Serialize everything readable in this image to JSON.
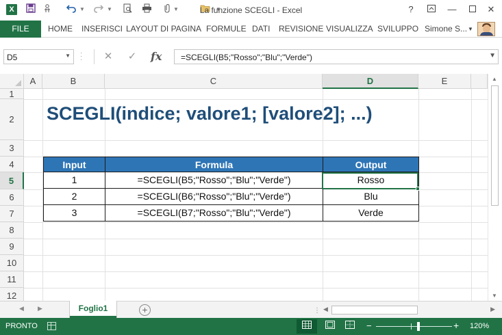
{
  "window": {
    "title": "La funzione SCEGLI - Excel",
    "app_icon": "X",
    "help": "?"
  },
  "quick_access": {
    "save_icon": "save-icon",
    "undo_icon": "undo-icon",
    "redo_icon": "redo-icon"
  },
  "ribbon": {
    "file": "FILE",
    "tabs": [
      "HOME",
      "INSERISCI",
      "LAYOUT DI PAGINA",
      "FORMULE",
      "DATI",
      "REVISIONE",
      "VISUALIZZA",
      "SVILUPPO"
    ],
    "user": "Simone S..."
  },
  "formula_bar": {
    "name_box": "D5",
    "fx": "fx",
    "formula": "=SCEGLI(B5;\"Rosso\";\"Blu\";\"Verde\")"
  },
  "grid": {
    "columns": [
      "A",
      "B",
      "C",
      "D",
      "E"
    ],
    "selected_column": "D",
    "rows": [
      "1",
      "2",
      "3",
      "4",
      "5",
      "6",
      "7",
      "8",
      "9",
      "10",
      "11",
      "12"
    ],
    "selected_row": "5"
  },
  "sheet": {
    "heading": "SCEGLI(indice; valore1; [valore2]; ...)",
    "table": {
      "headers": [
        "Input",
        "Formula",
        "Output"
      ],
      "rows": [
        [
          "1",
          "=SCEGLI(B5;\"Rosso\";\"Blu\";\"Verde\")",
          "Rosso"
        ],
        [
          "2",
          "=SCEGLI(B6;\"Rosso\";\"Blu\";\"Verde\")",
          "Blu"
        ],
        [
          "3",
          "=SCEGLI(B7;\"Rosso\";\"Blu\";\"Verde\")",
          "Verde"
        ]
      ]
    }
  },
  "sheet_tabs": {
    "active": "Foglio1",
    "add": "+"
  },
  "status": {
    "text": "PRONTO",
    "zoom": "120%"
  },
  "colors": {
    "excel_green": "#217346",
    "header_blue": "#2e75b6",
    "heading_blue": "#1f4e79"
  }
}
